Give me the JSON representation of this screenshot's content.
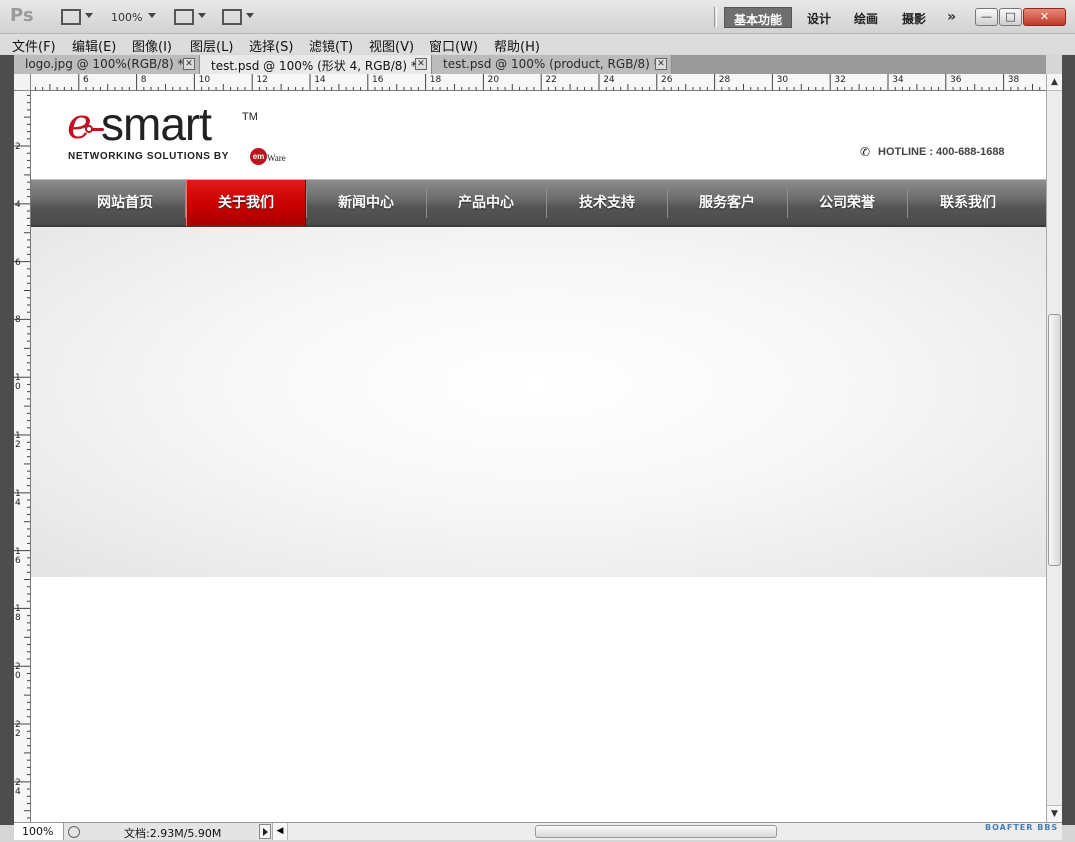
{
  "app": {
    "logo": "Ps",
    "zoom": "100%",
    "workspaces": [
      "基本功能",
      "设计",
      "绘画",
      "摄影"
    ],
    "more": "»"
  },
  "menus": [
    "文件(F)",
    "编辑(E)",
    "图像(I)",
    "图层(L)",
    "选择(S)",
    "滤镜(T)",
    "视图(V)",
    "窗口(W)",
    "帮助(H)"
  ],
  "tabs": [
    {
      "label": "logo.jpg @ 100%(RGB/8) *",
      "active": false
    },
    {
      "label": "test.psd @ 100% (形状 4, RGB/8) *",
      "active": true
    },
    {
      "label": "test.psd @ 100% (product, RGB/8) *",
      "active": false
    }
  ],
  "ruler": {
    "h_labels": [
      "6",
      "8",
      "10",
      "12",
      "14",
      "16",
      "18",
      "20",
      "22",
      "24",
      "26",
      "28",
      "30",
      "32",
      "34",
      "36",
      "38"
    ],
    "v_labels": [
      "2",
      "4",
      "6",
      "8",
      "10",
      "12",
      "14",
      "16",
      "18",
      "20",
      "22",
      "24"
    ]
  },
  "site": {
    "logo_e": "e",
    "logo_smart": "smart",
    "logo_tm": "TM",
    "logo_tagline": "NETWORKING SOLUTIONS BY",
    "logo_em": "em",
    "logo_ware": "Ware",
    "hotline": "HOTLINE : 400-688-1688",
    "nav": [
      "网站首页",
      "关于我们",
      "新闻中心",
      "产品中心",
      "技术支持",
      "服务客户",
      "公司荣誉",
      "联系我们"
    ],
    "nav_active_index": 1,
    "accent_color": "#c1121f"
  },
  "status": {
    "zoom": "100%",
    "doc": "文档:2.93M/5.90M"
  },
  "watermark": "BOAFTER BBS"
}
